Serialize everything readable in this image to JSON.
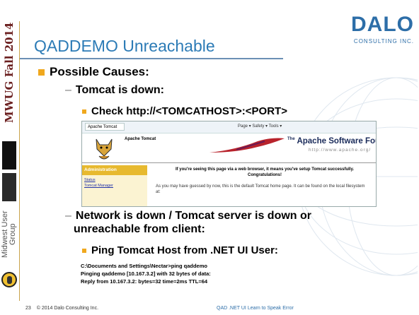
{
  "sidebar": {
    "event": "MWUG Fall 2014",
    "logo_text": "QAD",
    "group": "Midwest User Group"
  },
  "header": {
    "title": "QADDEMO Unreachable",
    "logo_main": "DALO",
    "logo_sub": "CONSULTING INC."
  },
  "bullets": {
    "l1": "Possible Causes:",
    "l2a": "Tomcat is down:",
    "l3a": "Check http://<TOMCATHOST>:<PORT>",
    "l2b_line1": "Network is down / Tomcat server is down or",
    "l2b_line2": "unreachable from client:",
    "l3b": "Ping Tomcat Host from .NET UI User:",
    "dash": "–"
  },
  "command_output": [
    "C:\\Documents and Settings\\Nectar>ping qaddemo",
    "Pinging qaddemo [10.167.3.2] with 32 bytes of data:",
    "Reply from 10.167.3.2: bytes=32 time=2ms TTL=64"
  ],
  "browser": {
    "tab": "Apache Tomcat",
    "tools": "Page ▾  Safety ▾  Tools ▾",
    "heading": "Apache Tomcat",
    "foundation": "Apache Software Foundation",
    "foundation_prefix": "The",
    "url": "http://www.apache.org/",
    "admin_title": "Administration",
    "admin_link1": "Status",
    "admin_link2": "Tomcat Manager",
    "message": "If you're seeing this page via a web browser, it means you've setup Tomcat successfully. Congratulations!",
    "message2": "As you may have guessed by now, this is the default Tomcat home page. It can be found on the local filesystem at:"
  },
  "footer": {
    "page": "23",
    "copyright": "© 2014 Dalo Consulting Inc.",
    "title": "QAD .NET UI Learn to Speak Error"
  },
  "colors": {
    "title": "#2c7bb6",
    "bullet": "#f0a81e",
    "logo": "#2d6ea8"
  }
}
